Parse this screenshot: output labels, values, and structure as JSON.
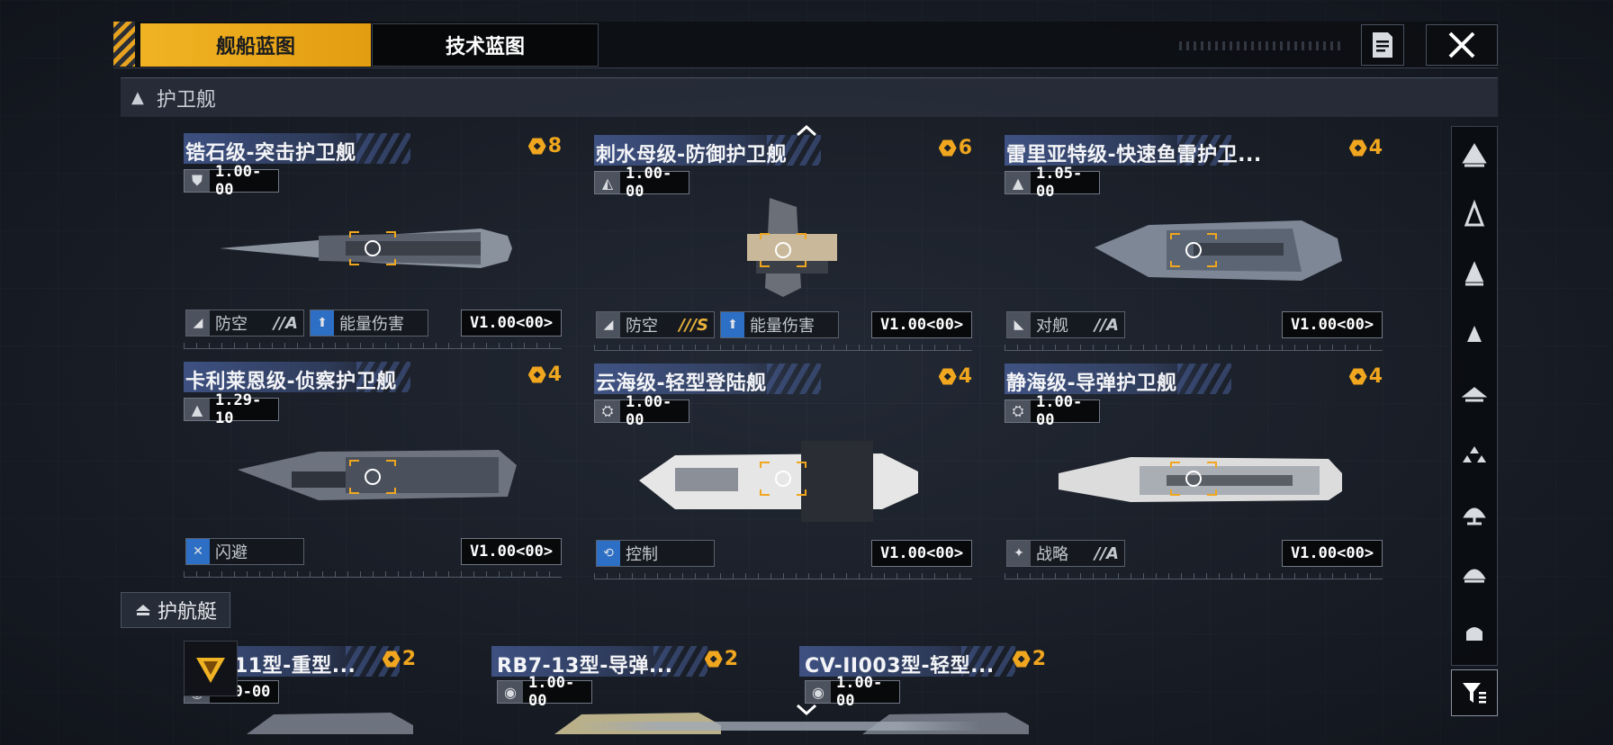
{
  "tabs": [
    {
      "label": "舰船蓝图",
      "active": true
    },
    {
      "label": "技术蓝图",
      "active": false
    }
  ],
  "toolbar": {
    "doc_icon": "document-icon",
    "close_icon": "close-icon"
  },
  "section_frigate": {
    "label": "护卫舰"
  },
  "section_corvette": {
    "label": "护航艇"
  },
  "ships": [
    {
      "name": "锆石级-突击护卫舰",
      "cost": "8",
      "stat_icon": "frigate-class-icon",
      "stat": "1.00-00",
      "tags": [
        {
          "label": "防空",
          "grade": "//A",
          "icon": "anti-air-icon"
        },
        {
          "label": "能量伤害",
          "grade": "",
          "icon": "energy-damage-icon"
        }
      ],
      "version": "V1.00<00>"
    },
    {
      "name": "刺水母级-防御护卫舰",
      "cost": "6",
      "stat_icon": "shield-class-icon",
      "stat": "1.00-00",
      "tags": [
        {
          "label": "防空",
          "grade": "///S",
          "icon": "anti-air-icon"
        },
        {
          "label": "能量伤害",
          "grade": "",
          "icon": "energy-damage-icon"
        }
      ],
      "version": "V1.00<00>"
    },
    {
      "name": "雷里亚特级-快速鱼雷护卫...",
      "cost": "4",
      "stat_icon": "torpedo-class-icon",
      "stat": "1.05-00",
      "tags": [
        {
          "label": "对舰",
          "grade": "//A",
          "icon": "anti-ship-icon"
        }
      ],
      "version": "V1.00<00>"
    },
    {
      "name": "卡利莱恩级-侦察护卫舰",
      "cost": "4",
      "stat_icon": "torpedo-class-icon",
      "stat": "1.29-10",
      "tags": [
        {
          "label": "闪避",
          "grade": "",
          "icon": "evasion-icon"
        }
      ],
      "version": "V1.00<00>"
    },
    {
      "name": "云海级-轻型登陆舰",
      "cost": "4",
      "stat_icon": "landing-class-icon",
      "stat": "1.00-00",
      "tags": [
        {
          "label": "控制",
          "grade": "",
          "icon": "control-icon"
        }
      ],
      "version": "V1.00<00>"
    },
    {
      "name": "静海级-导弹护卫舰",
      "cost": "4",
      "stat_icon": "landing-class-icon",
      "stat": "1.00-00",
      "tags": [
        {
          "label": "战略",
          "grade": "//A",
          "icon": "strategy-icon"
        }
      ],
      "version": "V1.00<00>"
    }
  ],
  "corvettes": [
    {
      "name": "11型-重型...",
      "cost": "2",
      "stat": ".00-00"
    },
    {
      "name": "RB7-13型-导弹...",
      "cost": "2",
      "stat": "1.00-00"
    },
    {
      "name": "CV-II003型-轻型...",
      "cost": "2",
      "stat": "1.00-00"
    }
  ],
  "sidebar_icons": [
    "carrier-icon",
    "destroyer-icon",
    "cruiser-icon",
    "frigate-icon",
    "corvette-icon",
    "fighter-icon",
    "auxiliary-icon",
    "battleship-icon",
    "station-icon"
  ],
  "colors": {
    "accent": "#f0b323",
    "cost": "#f0a61e",
    "title_band": "#4a62a0",
    "energy_tag": "#2c6fc4"
  }
}
